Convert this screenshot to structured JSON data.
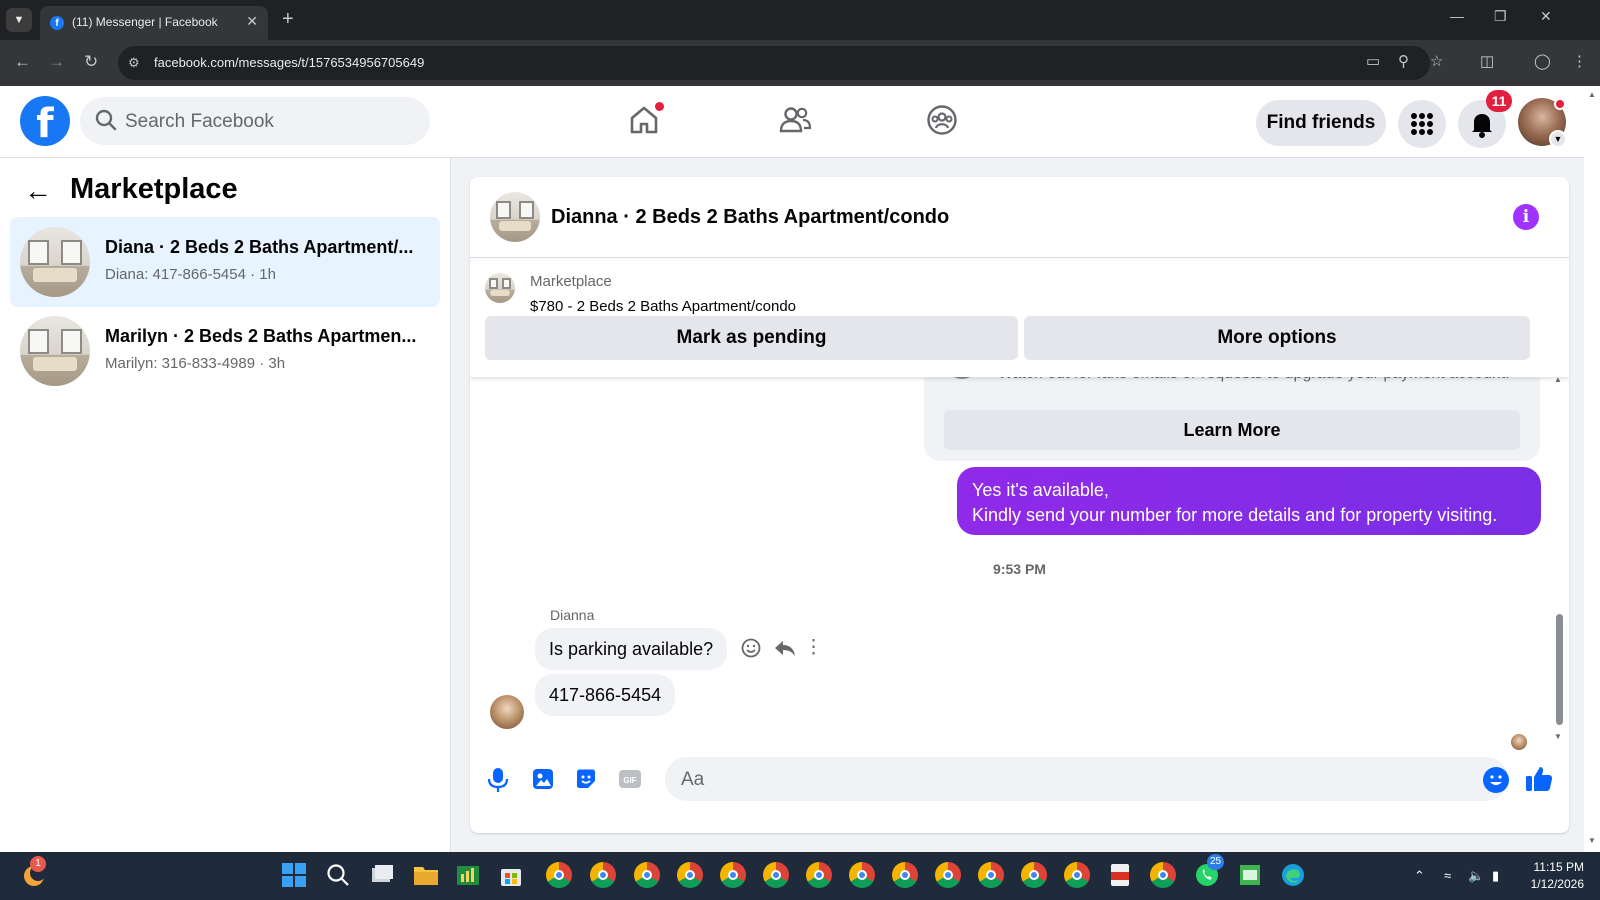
{
  "browser": {
    "tab_title": "(11) Messenger | Facebook",
    "url": "facebook.com/messages/t/1576534956705649"
  },
  "header": {
    "search_placeholder": "Search Facebook",
    "find_friends": "Find friends",
    "notification_count": "11"
  },
  "sidebar": {
    "title": "Marketplace",
    "conversations": [
      {
        "name": "Diana · 2 Beds 2 Baths Apartment/...",
        "preview": "Diana: 417-866-5454 · 1h",
        "active": true
      },
      {
        "name": "Marilyn · 2 Beds 2 Baths Apartmen...",
        "preview": "Marilyn: 316-833-4989 · 3h",
        "active": false
      }
    ]
  },
  "chat": {
    "title": "Dianna · 2 Beds 2 Baths Apartment/condo",
    "marketplace_label": "Marketplace",
    "listing": "$780 - 2 Beds 2 Baths Apartment/condo",
    "mark_pending": "Mark as pending",
    "more_options": "More options",
    "warning_text": "Watch out for fake emails or requests to upgrade your payment account.",
    "learn_more": "Learn More",
    "outgoing_message": {
      "line1": "Yes it's available,",
      "line2": "Kindly send your number for more details and for property visiting."
    },
    "timestamp": "9:53 PM",
    "sender_name": "Dianna",
    "incoming_messages": [
      "Is parking available?",
      "417-866-5454"
    ],
    "composer_placeholder": "Aa",
    "accent_color": "#8a2be2"
  },
  "taskbar": {
    "time": "11:15 PM",
    "date": "1/12/2026",
    "whatsapp_badge": "25",
    "app_badge": "1"
  }
}
